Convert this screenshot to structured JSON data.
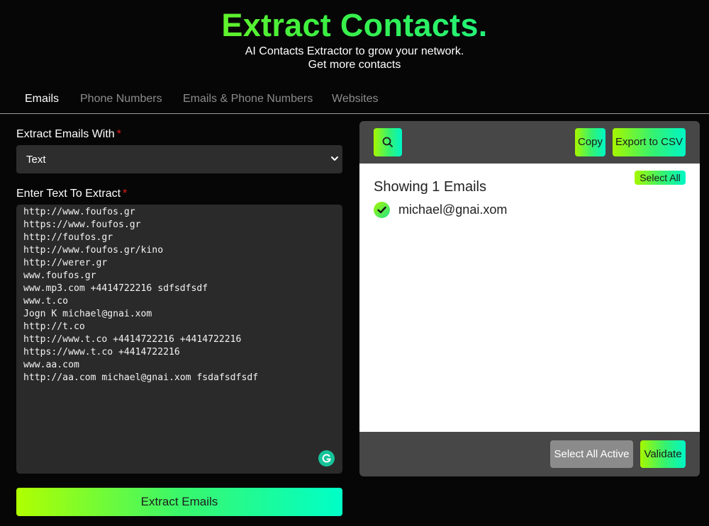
{
  "header": {
    "title": "Extract Contacts.",
    "subtitle_line1": "AI Contacts Extractor to grow your network.",
    "subtitle_line2": "Get more contacts"
  },
  "tabs": [
    {
      "label": "Emails",
      "active": true
    },
    {
      "label": "Phone Numbers",
      "active": false
    },
    {
      "label": "Emails & Phone Numbers",
      "active": false
    },
    {
      "label": "Websites",
      "active": false
    }
  ],
  "form": {
    "extract_with_label": "Extract Emails With",
    "required_mark": "*",
    "extract_with_value": "Text",
    "text_label": "Enter Text To Extract",
    "text_value": "http://www.foufos.gr\nhttps://www.foufos.gr\nhttp://foufos.gr\nhttp://www.foufos.gr/kino\nhttp://werer.gr\nwww.foufos.gr\nwww.mp3.com +4414722216 sdfsdfsdf\nwww.t.co\nJogn K michael@gnai.xom\nhttp://t.co\nhttp://www.t.co +4414722216 +4414722216\nhttps://www.t.co +4414722216\nwww.aa.com\nhttp://aa.com michael@gnai.xom fsdafsdfsdf",
    "extract_button": "Extract Emails"
  },
  "results": {
    "search_icon": "search-icon",
    "copy_button": "Copy",
    "export_button": "Export to CSV",
    "showing_text": "Showing 1 Emails",
    "select_all_button": "Select All",
    "emails": [
      {
        "address": "michael@gnai.xom",
        "checked": true
      }
    ],
    "select_all_active_button": "Select All Active",
    "validate_button": "Validate"
  },
  "colors": {
    "accent_start": "#b0ff00",
    "accent_mid": "#3af76a",
    "accent_end": "#00ffc8",
    "required": "#e31b1b",
    "background": "#060606"
  }
}
